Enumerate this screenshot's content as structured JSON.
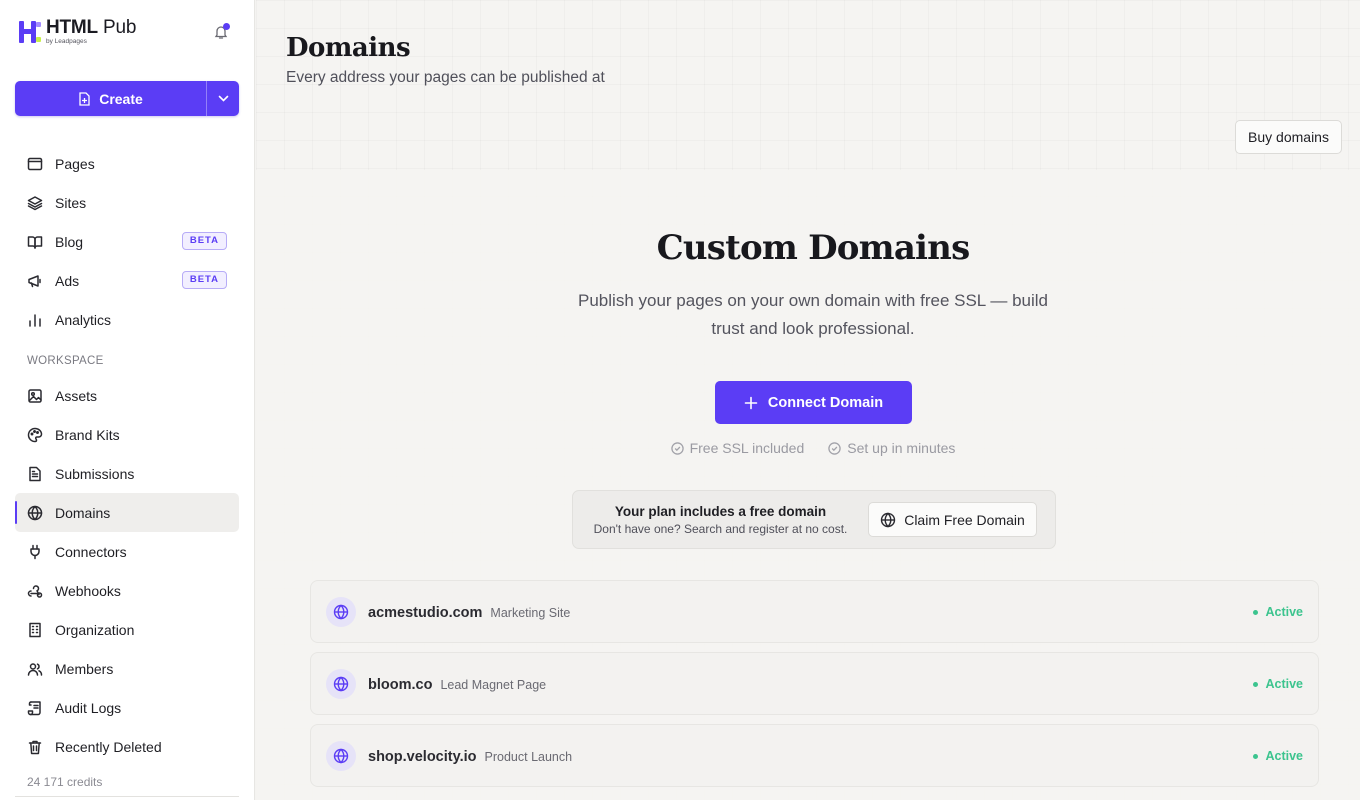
{
  "brand": {
    "name_bold": "HTML",
    "name_rest": " Pub",
    "by": "by Leadpages"
  },
  "create": {
    "label": "Create"
  },
  "nav": {
    "items": [
      {
        "label": "Pages",
        "icon": "browser-window-icon"
      },
      {
        "label": "Sites",
        "icon": "layers-icon"
      },
      {
        "label": "Blog",
        "icon": "open-book-icon",
        "badge": "BETA"
      },
      {
        "label": "Ads",
        "icon": "megaphone-icon",
        "badge": "BETA"
      },
      {
        "label": "Analytics",
        "icon": "bar-chart-icon"
      }
    ],
    "workspace_label": "WORKSPACE",
    "workspace_items": [
      {
        "label": "Assets",
        "icon": "image-icon"
      },
      {
        "label": "Brand Kits",
        "icon": "palette-icon"
      },
      {
        "label": "Submissions",
        "icon": "document-icon"
      },
      {
        "label": "Domains",
        "icon": "globe-icon",
        "active": true
      },
      {
        "label": "Connectors",
        "icon": "plug-icon"
      },
      {
        "label": "Webhooks",
        "icon": "webhook-icon"
      },
      {
        "label": "Organization",
        "icon": "building-icon"
      },
      {
        "label": "Members",
        "icon": "users-icon"
      },
      {
        "label": "Audit Logs",
        "icon": "scroll-icon"
      },
      {
        "label": "Recently Deleted",
        "icon": "trash-icon"
      }
    ],
    "credits": "24 171 credits"
  },
  "header": {
    "title": "Domains",
    "subtitle": "Every address your pages can be published at",
    "buy_label": "Buy domains"
  },
  "hero": {
    "title": "Custom Domains",
    "subtitle": "Publish your pages on your own domain with free SSL — build trust and look professional.",
    "connect_label": "Connect Domain",
    "perks": [
      "Free SSL included",
      "Set up in minutes"
    ]
  },
  "plan": {
    "title": "Your plan includes a free domain",
    "subtitle": "Don't have one? Search and register at no cost.",
    "claim_label": "Claim Free Domain"
  },
  "domains": [
    {
      "domain": "acmestudio.com",
      "label": "Marketing Site",
      "status": "Active"
    },
    {
      "domain": "bloom.co",
      "label": "Lead Magnet Page",
      "status": "Active"
    },
    {
      "domain": "shop.velocity.io",
      "label": "Product Launch",
      "status": "Active"
    }
  ],
  "colors": {
    "accent": "#5b3df5",
    "active_status": "#3cc48e"
  }
}
